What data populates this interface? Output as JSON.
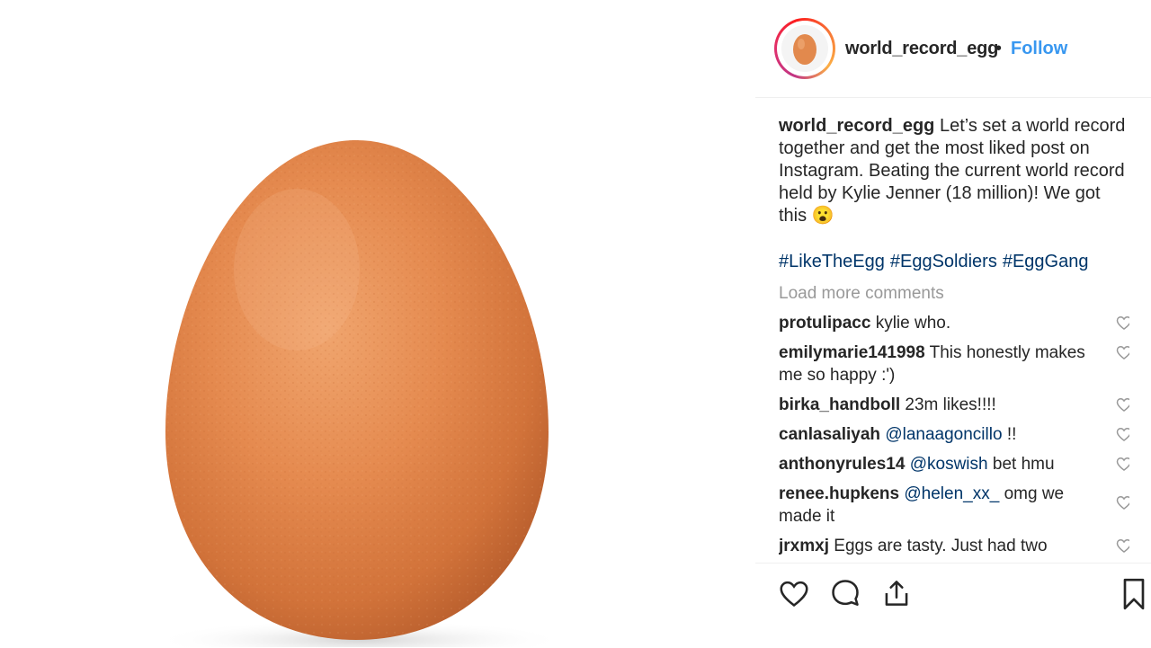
{
  "post": {
    "username": "world_record_egg",
    "follow_label": "Follow",
    "separator": "•",
    "caption_text": "Let’s set a world record together and get the most liked post on Instagram. Beating the current world record held by Kylie Jenner (18 million)! We got this",
    "caption_emoji": "😮",
    "hashtags": [
      "#LikeTheEgg",
      "#EggSoldiers",
      "#EggGang"
    ]
  },
  "load_more_label": "Load more comments",
  "comments": [
    {
      "user": "protulipacc",
      "text": "kylie who."
    },
    {
      "user": "emilymarie141998",
      "text": "This honestly makes me so happy :')"
    },
    {
      "user": "birka_handboll",
      "text": "23m likes!!!!"
    },
    {
      "user": "canlasaliyah",
      "mention": "@lanaagoncillo",
      "text": "!!"
    },
    {
      "user": "anthonyrules14",
      "mention": "@koswish",
      "text": "bet hmu"
    },
    {
      "user": "renee.hupkens",
      "mention": "@helen_xx_",
      "text": "omg we made it"
    },
    {
      "user": "jrxmxj",
      "text": "Eggs are tasty. Just had two"
    }
  ],
  "icons": {
    "like": "heart-icon",
    "comment": "comment-bubble-icon",
    "share": "share-icon",
    "save": "bookmark-icon",
    "comment_like": "heart-icon"
  },
  "colors": {
    "link_blue": "#3897f0",
    "hashtag_blue": "#003569",
    "muted_gray": "#999999",
    "text": "#262626"
  }
}
